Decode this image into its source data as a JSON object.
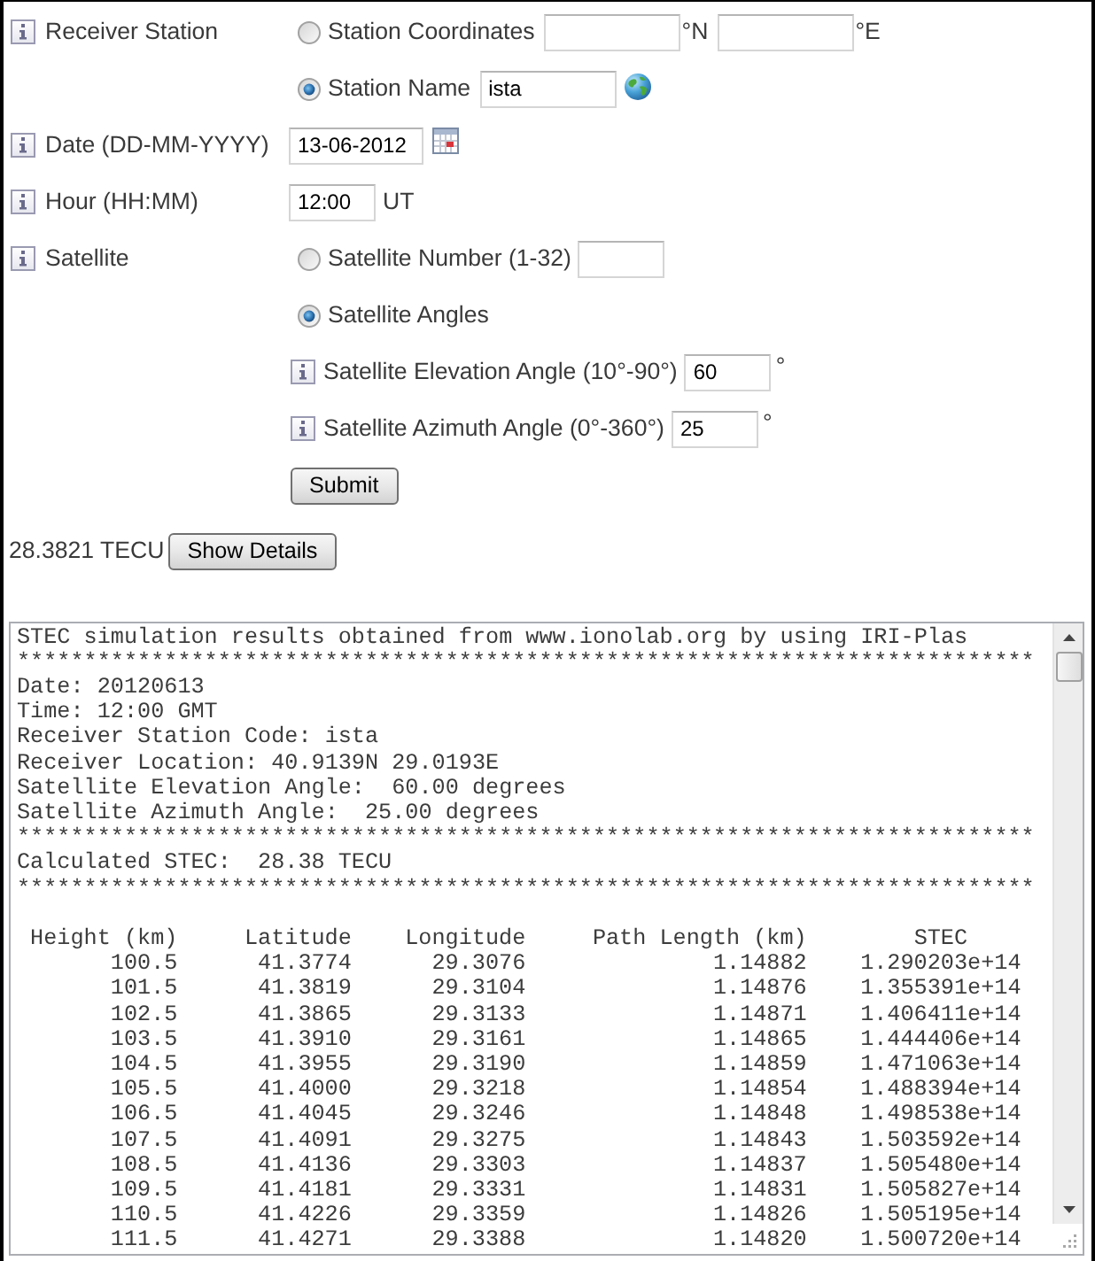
{
  "form": {
    "receiver_station": {
      "label": "Receiver Station",
      "options": [
        {
          "kind": "coordinates",
          "label": "Station Coordinates",
          "selected": false,
          "latitude_unit": "°N",
          "longitude_unit": "°E"
        },
        {
          "kind": "name",
          "label": "Station Name",
          "selected": true,
          "value": "ista"
        }
      ]
    },
    "date": {
      "label": "Date (DD-MM-YYYY)",
      "value": "13-06-2012"
    },
    "hour": {
      "label": "Hour (HH:MM)",
      "value": "12:00",
      "unit": "UT"
    },
    "satellite": {
      "label": "Satellite",
      "options": [
        {
          "kind": "number",
          "label": "Satellite Number (1-32)",
          "selected": false
        },
        {
          "kind": "angles",
          "label": "Satellite Angles",
          "selected": true
        }
      ],
      "angles": [
        {
          "label": "Satellite Elevation Angle (10°-90°)",
          "value": "60",
          "unit": "°"
        },
        {
          "label": "Satellite Azimuth Angle (0°-360°)",
          "value": "25",
          "unit": "°"
        }
      ]
    },
    "submit_button": "Submit"
  },
  "result": {
    "value": "28.3821 TECU",
    "details_button": "Show Details"
  },
  "output": {
    "lines": [
      "STEC simulation results obtained from www.ionolab.org by using IRI-Plas",
      "****************************************************************************",
      "Date: 20120613",
      "Time: 12:00 GMT",
      "Receiver Station Code: ista",
      "Receiver Location: 40.9139N 29.0193E",
      "Satellite Elevation Angle:  60.00 degrees",
      "Satellite Azimuth Angle:  25.00 degrees",
      "****************************************************************************",
      "Calculated STEC:  28.38 TECU",
      "****************************************************************************"
    ],
    "table": {
      "columns": [
        "Height (km)",
        "Latitude",
        "Longitude",
        "Path Length (km)",
        "STEC"
      ],
      "rows": [
        [
          "100.5",
          "41.3774",
          "29.3076",
          "1.14882",
          "1.290203e+14"
        ],
        [
          "101.5",
          "41.3819",
          "29.3104",
          "1.14876",
          "1.355391e+14"
        ],
        [
          "102.5",
          "41.3865",
          "29.3133",
          "1.14871",
          "1.406411e+14"
        ],
        [
          "103.5",
          "41.3910",
          "29.3161",
          "1.14865",
          "1.444406e+14"
        ],
        [
          "104.5",
          "41.3955",
          "29.3190",
          "1.14859",
          "1.471063e+14"
        ],
        [
          "105.5",
          "41.4000",
          "29.3218",
          "1.14854",
          "1.488394e+14"
        ],
        [
          "106.5",
          "41.4045",
          "29.3246",
          "1.14848",
          "1.498538e+14"
        ],
        [
          "107.5",
          "41.4091",
          "29.3275",
          "1.14843",
          "1.503592e+14"
        ],
        [
          "108.5",
          "41.4136",
          "29.3303",
          "1.14837",
          "1.505480e+14"
        ],
        [
          "109.5",
          "41.4181",
          "29.3331",
          "1.14831",
          "1.505827e+14"
        ],
        [
          "110.5",
          "41.4226",
          "29.3359",
          "1.14826",
          "1.505195e+14"
        ],
        [
          "111.5",
          "41.4271",
          "29.3388",
          "1.14820",
          "1.500720e+14"
        ]
      ]
    }
  }
}
